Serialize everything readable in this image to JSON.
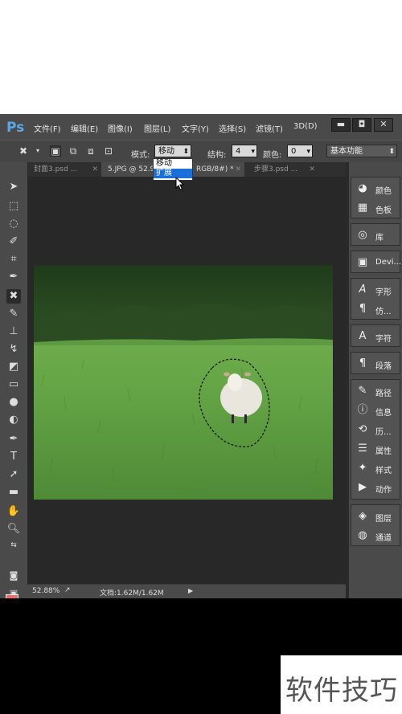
{
  "app": {
    "logo": "Ps"
  },
  "menu": [
    "文件(F)",
    "编辑(E)",
    "图像(I)",
    "图层(L)",
    "文字(Y)",
    "选择(S)",
    "滤镜(T)",
    "3D(D)"
  ],
  "window_controls": {
    "minimize": "▬",
    "restore": "◘",
    "close": "✕"
  },
  "options_bar": {
    "mode_label": "模式:",
    "mode_value": "移动",
    "mode_options": [
      "移动",
      "扩展"
    ],
    "structure_label": "结构:",
    "structure_value": "4",
    "color_label": "颜色:",
    "color_value": "0",
    "workspace_value": "基本功能"
  },
  "tabs": [
    {
      "label": "封面3.psd ...",
      "close": "✕"
    },
    {
      "label": "5.JPG @ 52.9",
      "close": ""
    },
    {
      "label": "RGB/8#) *",
      "close": "✕"
    },
    {
      "label": "步骤3.psd ...",
      "close": "✕"
    }
  ],
  "status": {
    "zoom": "52.88%",
    "doc": "文档:1.62M/1.62M",
    "arrow": "▶"
  },
  "panels": [
    {
      "icon": "palette-icon",
      "glyph": "◕",
      "label": "颜色"
    },
    {
      "icon": "swatches-icon",
      "glyph": "▦",
      "label": "色板"
    },
    {
      "icon": "libraries-icon",
      "glyph": "◎",
      "label": "库"
    },
    {
      "icon": "device-preview-icon",
      "glyph": "▣",
      "label": "Devi..."
    },
    {
      "icon": "character-icon",
      "glyph": "A",
      "label": "字形"
    },
    {
      "icon": "paragraph-styles-icon",
      "glyph": "¶",
      "label": "仿..."
    },
    {
      "icon": "character-panel-icon",
      "glyph": "A",
      "label": "字符"
    },
    {
      "icon": "paragraph-icon",
      "glyph": "¶",
      "label": "段落"
    },
    {
      "icon": "paths-icon",
      "glyph": "✎",
      "label": "路径"
    },
    {
      "icon": "info-icon",
      "glyph": "ⓘ",
      "label": "信息"
    },
    {
      "icon": "history-icon",
      "glyph": "⟲",
      "label": "历..."
    },
    {
      "icon": "properties-icon",
      "glyph": "☰",
      "label": "属性"
    },
    {
      "icon": "styles-icon",
      "glyph": "✦",
      "label": "样式"
    },
    {
      "icon": "actions-icon",
      "glyph": "▶",
      "label": "动作"
    },
    {
      "icon": "layers-icon",
      "glyph": "◈",
      "label": "图层"
    },
    {
      "icon": "channels-icon",
      "glyph": "◍",
      "label": "通道"
    }
  ],
  "colors": {
    "foreground": "#f06868",
    "background": "#000000"
  },
  "watermark": "软件技巧"
}
